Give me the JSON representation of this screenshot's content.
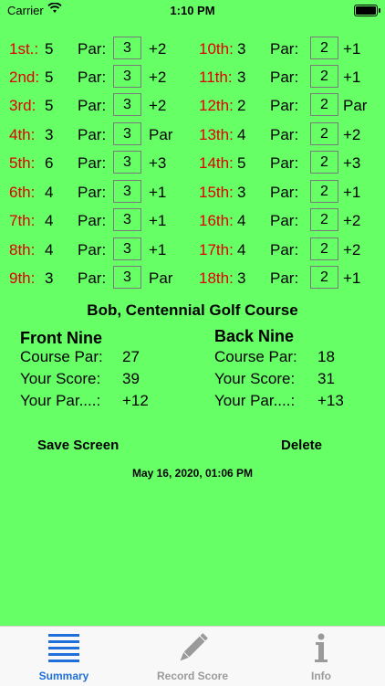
{
  "status_bar": {
    "carrier": "Carrier",
    "time": "1:10 PM"
  },
  "holes_front": [
    {
      "num": "1st.:",
      "score": "5",
      "par_label": "Par:",
      "par": "3",
      "diff": "+2"
    },
    {
      "num": "2nd:",
      "score": "5",
      "par_label": "Par:",
      "par": "3",
      "diff": "+2"
    },
    {
      "num": "3rd:",
      "score": "5",
      "par_label": "Par:",
      "par": "3",
      "diff": "+2"
    },
    {
      "num": "4th:",
      "score": "3",
      "par_label": "Par:",
      "par": "3",
      "diff": "Par"
    },
    {
      "num": "5th:",
      "score": "6",
      "par_label": "Par:",
      "par": "3",
      "diff": "+3"
    },
    {
      "num": "6th:",
      "score": "4",
      "par_label": "Par:",
      "par": "3",
      "diff": "+1"
    },
    {
      "num": "7th:",
      "score": "4",
      "par_label": "Par:",
      "par": "3",
      "diff": "+1"
    },
    {
      "num": "8th:",
      "score": "4",
      "par_label": "Par:",
      "par": "3",
      "diff": "+1"
    },
    {
      "num": "9th:",
      "score": "3",
      "par_label": "Par:",
      "par": "3",
      "diff": "Par"
    }
  ],
  "holes_back": [
    {
      "num": "10th:",
      "score": "3",
      "par_label": "Par:",
      "par": "2",
      "diff": "+1"
    },
    {
      "num": "11th:",
      "score": "3",
      "par_label": "Par:",
      "par": "2",
      "diff": "+1"
    },
    {
      "num": "12th:",
      "score": "2",
      "par_label": "Par:",
      "par": "2",
      "diff": "Par"
    },
    {
      "num": "13th:",
      "score": "4",
      "par_label": "Par:",
      "par": "2",
      "diff": "+2"
    },
    {
      "num": "14th:",
      "score": "5",
      "par_label": "Par:",
      "par": "2",
      "diff": "+3"
    },
    {
      "num": "15th:",
      "score": "3",
      "par_label": "Par:",
      "par": "2",
      "diff": "+1"
    },
    {
      "num": "16th:",
      "score": "4",
      "par_label": "Par:",
      "par": "2",
      "diff": "+2"
    },
    {
      "num": "17th:",
      "score": "4",
      "par_label": "Par:",
      "par": "2",
      "diff": "+2"
    },
    {
      "num": "18th:",
      "score": "3",
      "par_label": "Par:",
      "par": "2",
      "diff": "+1"
    }
  ],
  "title": "Bob, Centennial Golf Course",
  "front_nine": {
    "heading": "Front Nine",
    "course_par_label": "Course Par:",
    "course_par": "27",
    "score_label": "Your Score:",
    "score": "39",
    "par_label": "Your Par....:",
    "par": "+12"
  },
  "back_nine": {
    "heading": "Back Nine",
    "course_par_label": "Course Par:",
    "course_par": "18",
    "score_label": "Your Score:",
    "score": "31",
    "par_label": "Your Par....:",
    "par": "+13"
  },
  "actions": {
    "save": "Save Screen",
    "delete": "Delete"
  },
  "timestamp": "May 16, 2020, 01:06 PM",
  "tabs": [
    {
      "label": "Summary",
      "icon": "list-icon",
      "active": true
    },
    {
      "label": "Record Score",
      "icon": "pencil-icon",
      "active": false
    },
    {
      "label": "Info",
      "icon": "info-icon",
      "active": false
    }
  ],
  "colors": {
    "background": "#66ff66",
    "hole_number": "#e00000",
    "tab_active": "#1e6fd9",
    "tab_inactive": "#9a9a9a"
  }
}
